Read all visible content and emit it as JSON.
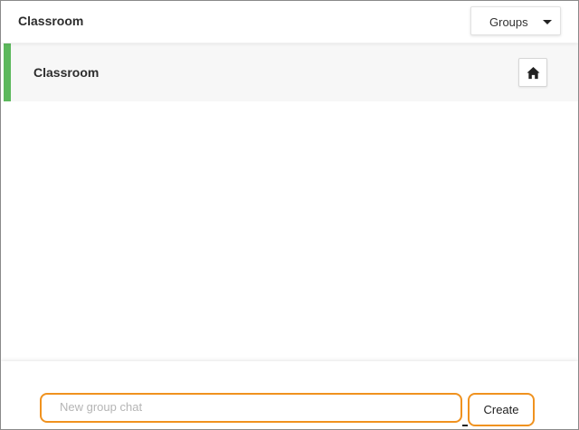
{
  "header": {
    "title": "Classroom",
    "groups_dropdown": {
      "selected": "Groups"
    }
  },
  "groups": [
    {
      "label": "Classroom",
      "active": true,
      "indicator_color": "#5cb85c",
      "action_icon": "home-icon"
    }
  ],
  "footer": {
    "new_group_placeholder": "New group chat",
    "new_group_value": "",
    "create_label": "Create",
    "highlight_color": "#f0921f"
  }
}
